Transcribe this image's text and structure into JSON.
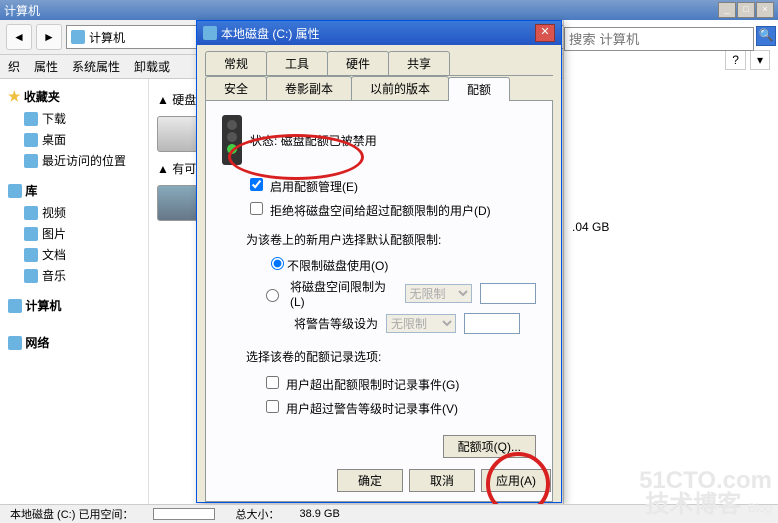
{
  "parent_window": {
    "title": "计算机"
  },
  "nav": {
    "address": "计算机"
  },
  "menubar": {
    "items": [
      "织",
      "属性",
      "系统属性",
      "卸载或"
    ]
  },
  "sidebar": {
    "favorites": {
      "label": "收藏夹",
      "items": [
        "下载",
        "桌面",
        "最近访问的位置"
      ]
    },
    "libraries": {
      "label": "库",
      "items": [
        "视频",
        "图片",
        "文档",
        "音乐"
      ]
    },
    "computer": {
      "label": "计算机"
    },
    "network": {
      "label": "网络"
    }
  },
  "content": {
    "hdd_section": "硬盘 (",
    "removable_section": "有可移"
  },
  "detail": {
    "capacity": ".04 GB"
  },
  "dialog": {
    "title": "本地磁盘 (C:) 属性",
    "tabs_row1": [
      "常规",
      "工具",
      "硬件",
      "共享"
    ],
    "tabs_row2": [
      "安全",
      "卷影副本",
      "以前的版本",
      "配额"
    ],
    "status_label": "状态:",
    "status_text": "磁盘配额已被禁用",
    "enable_quota": "启用配额管理(E)",
    "deny_exceed": "拒绝将磁盘空间给超过配额限制的用户(D)",
    "default_label": "为该卷上的新用户选择默认配额限制:",
    "radio_nolimit": "不限制磁盘使用(O)",
    "radio_limit": "将磁盘空间限制为(L)",
    "warn_label": "将警告等级设为",
    "combo_nolimit": "无限制",
    "log_label": "选择该卷的配额记录选项:",
    "log_exceed": "用户超出配额限制时记录事件(G)",
    "log_warn": "用户超过警告等级时记录事件(V)",
    "quota_entries": "配额项(Q)...",
    "ok": "确定",
    "cancel": "取消",
    "apply": "应用(A)"
  },
  "search": {
    "placeholder": "搜索 计算机"
  },
  "statusbar": {
    "drive_label": "本地磁盘 (C:) 已用空间：",
    "size_label": "总大小：",
    "size_value": "38.9 GB"
  },
  "watermark": {
    "line1": "51CTO.com",
    "line2": "技术博客",
    "line3": "Blog"
  }
}
